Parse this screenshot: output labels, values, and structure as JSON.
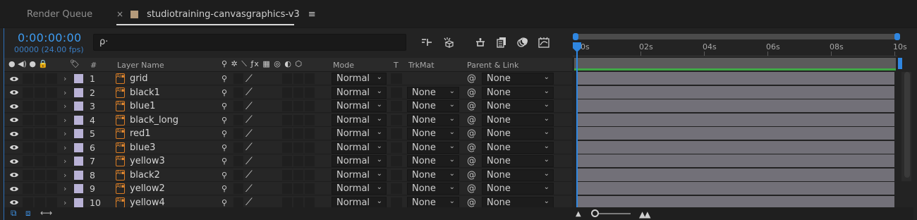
{
  "tabs": {
    "render_queue": "Render Queue",
    "close": "×",
    "comp_name": "studiotraining-canvasgraphics-v3",
    "menu": "≡"
  },
  "timecode": "0:00:00:00",
  "fps": "00000 (24.00 fps)",
  "search": {
    "icon": "ρ·",
    "value": ""
  },
  "columns": {
    "number": "#",
    "layer_name": "Layer Name",
    "mode": "Mode",
    "t": "T",
    "trkmat": "TrkMat",
    "parent_link": "Parent & Link"
  },
  "layers": [
    {
      "num": "1",
      "name": "grid",
      "mode": "Normal",
      "trkmat": "",
      "parent": "None"
    },
    {
      "num": "2",
      "name": "black1",
      "mode": "Normal",
      "trkmat": "None",
      "parent": "None"
    },
    {
      "num": "3",
      "name": "blue1",
      "mode": "Normal",
      "trkmat": "None",
      "parent": "None"
    },
    {
      "num": "4",
      "name": "black_long",
      "mode": "Normal",
      "trkmat": "None",
      "parent": "None"
    },
    {
      "num": "5",
      "name": "red1",
      "mode": "Normal",
      "trkmat": "None",
      "parent": "None"
    },
    {
      "num": "6",
      "name": "blue3",
      "mode": "Normal",
      "trkmat": "None",
      "parent": "None"
    },
    {
      "num": "7",
      "name": "yellow3",
      "mode": "Normal",
      "trkmat": "None",
      "parent": "None"
    },
    {
      "num": "8",
      "name": "black2",
      "mode": "Normal",
      "trkmat": "None",
      "parent": "None"
    },
    {
      "num": "9",
      "name": "yellow2",
      "mode": "Normal",
      "trkmat": "None",
      "parent": "None"
    },
    {
      "num": "10",
      "name": "yellow4",
      "mode": "Normal",
      "trkmat": "None",
      "parent": "None"
    }
  ],
  "ruler": [
    "00s",
    "02s",
    "04s",
    "06s",
    "08s",
    "10s"
  ],
  "colors": {
    "accent_blue": "#2f86e0",
    "timecode_blue": "#3d9bf0",
    "label_lavender": "#b9b2d6",
    "ai_orange": "#d97b22",
    "work_area_green": "#3fa845",
    "track_bar": "#727078"
  },
  "icons": {
    "eye": "eye-icon",
    "ai_file": "illustrator-file-icon",
    "pickwhip": "pickwhip-icon"
  }
}
